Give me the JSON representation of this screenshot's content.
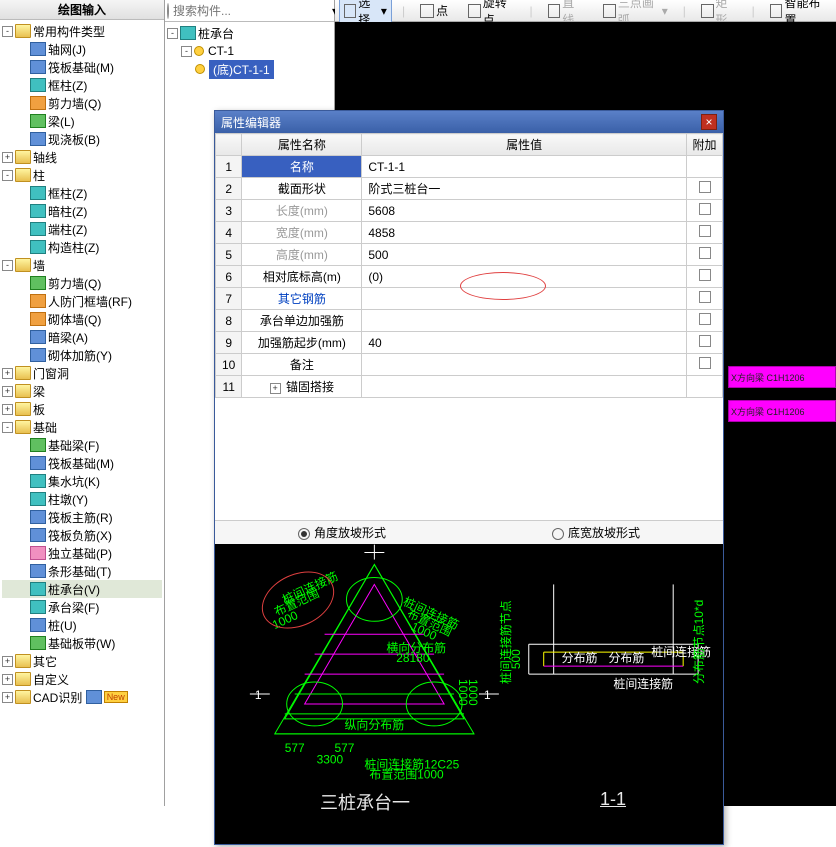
{
  "left_panel": {
    "title": "绘图输入",
    "root": "常用构件类型",
    "items": [
      {
        "icon": "grid",
        "label": "轴网(J)"
      },
      {
        "icon": "grid",
        "label": "筏板基础(M)"
      },
      {
        "icon": "col",
        "label": "框柱(Z)"
      },
      {
        "icon": "wall",
        "label": "剪力墙(Q)"
      },
      {
        "icon": "beam",
        "label": "梁(L)"
      },
      {
        "icon": "slab",
        "label": "现浇板(B)"
      }
    ],
    "groups": [
      {
        "toggle": "+",
        "label": "轴线"
      },
      {
        "toggle": "-",
        "label": "柱",
        "children": [
          {
            "icon": "col",
            "label": "框柱(Z)"
          },
          {
            "icon": "col",
            "label": "暗柱(Z)"
          },
          {
            "icon": "col",
            "label": "端柱(Z)"
          },
          {
            "icon": "col",
            "label": "构造柱(Z)"
          }
        ]
      },
      {
        "toggle": "-",
        "label": "墙",
        "children": [
          {
            "icon": "wall",
            "label": "剪力墙(Q)"
          },
          {
            "icon": "wall",
            "label": "人防门框墙(RF)"
          },
          {
            "icon": "wall",
            "label": "砌体墙(Q)"
          },
          {
            "icon": "wall",
            "label": "暗梁(A)"
          },
          {
            "icon": "wall",
            "label": "砌体加筋(Y)"
          }
        ]
      },
      {
        "toggle": "+",
        "label": "门窗洞"
      },
      {
        "toggle": "+",
        "label": "梁"
      },
      {
        "toggle": "+",
        "label": "板"
      },
      {
        "toggle": "-",
        "label": "基础",
        "children": [
          {
            "icon": "fnd",
            "label": "基础梁(F)"
          },
          {
            "icon": "fnd",
            "label": "筏板基础(M)"
          },
          {
            "icon": "fnd",
            "label": "集水坑(K)"
          },
          {
            "icon": "fnd",
            "label": "柱墩(Y)"
          },
          {
            "icon": "fnd",
            "label": "筏板主筋(R)"
          },
          {
            "icon": "fnd",
            "label": "筏板负筋(X)"
          },
          {
            "icon": "fnd",
            "label": "独立基础(P)"
          },
          {
            "icon": "fnd",
            "label": "条形基础(T)"
          },
          {
            "icon": "fnd",
            "label": "桩承台(V)",
            "selected": true
          },
          {
            "icon": "fnd",
            "label": "承台梁(F)"
          },
          {
            "icon": "fnd",
            "label": "桩(U)"
          },
          {
            "icon": "fnd",
            "label": "基础板带(W)"
          }
        ]
      },
      {
        "toggle": "+",
        "label": "其它"
      },
      {
        "toggle": "+",
        "label": "自定义"
      },
      {
        "toggle": "+",
        "label": "CAD识别",
        "new": true
      }
    ]
  },
  "mid_panel": {
    "placeholder": "搜索构件...",
    "root": "桩承台",
    "l1": "CT-1",
    "l2": "(底)CT-1-1"
  },
  "toolbar": {
    "select": "选择",
    "point": "点",
    "rotpoint": "旋转点",
    "line": "直线",
    "arc": "三点画弧",
    "rect": "矩形",
    "smart": "智能布置"
  },
  "dialog": {
    "title": "属性编辑器",
    "hdr_name": "属性名称",
    "hdr_value": "属性值",
    "hdr_add": "附加",
    "rows": [
      {
        "n": "1",
        "label": "名称",
        "value": "CT-1-1",
        "hl": true
      },
      {
        "n": "2",
        "label": "截面形状",
        "value": "阶式三桩台一"
      },
      {
        "n": "3",
        "label": "长度(mm)",
        "value": "5608",
        "gray": true
      },
      {
        "n": "4",
        "label": "宽度(mm)",
        "value": "4858",
        "gray": true
      },
      {
        "n": "5",
        "label": "高度(mm)",
        "value": "500",
        "gray": true
      },
      {
        "n": "6",
        "label": "相对底标高(m)",
        "value": "(0)"
      },
      {
        "n": "7",
        "label": "其它钢筋",
        "value": "",
        "blue": true
      },
      {
        "n": "8",
        "label": "承台单边加强筋",
        "value": ""
      },
      {
        "n": "9",
        "label": "加强筋起步(mm)",
        "value": "40"
      },
      {
        "n": "10",
        "label": "备注",
        "value": ""
      },
      {
        "n": "11",
        "label": "锚固搭接",
        "value": "",
        "exp": true
      }
    ],
    "radio1": "角度放坡形式",
    "radio2": "底宽放坡形式",
    "diag_label1": "三桩承台一",
    "diag_label2": "1-1"
  },
  "magenta": {
    "a": "X方向梁 C1H1206",
    "b": "X方向梁 C1H1206"
  }
}
